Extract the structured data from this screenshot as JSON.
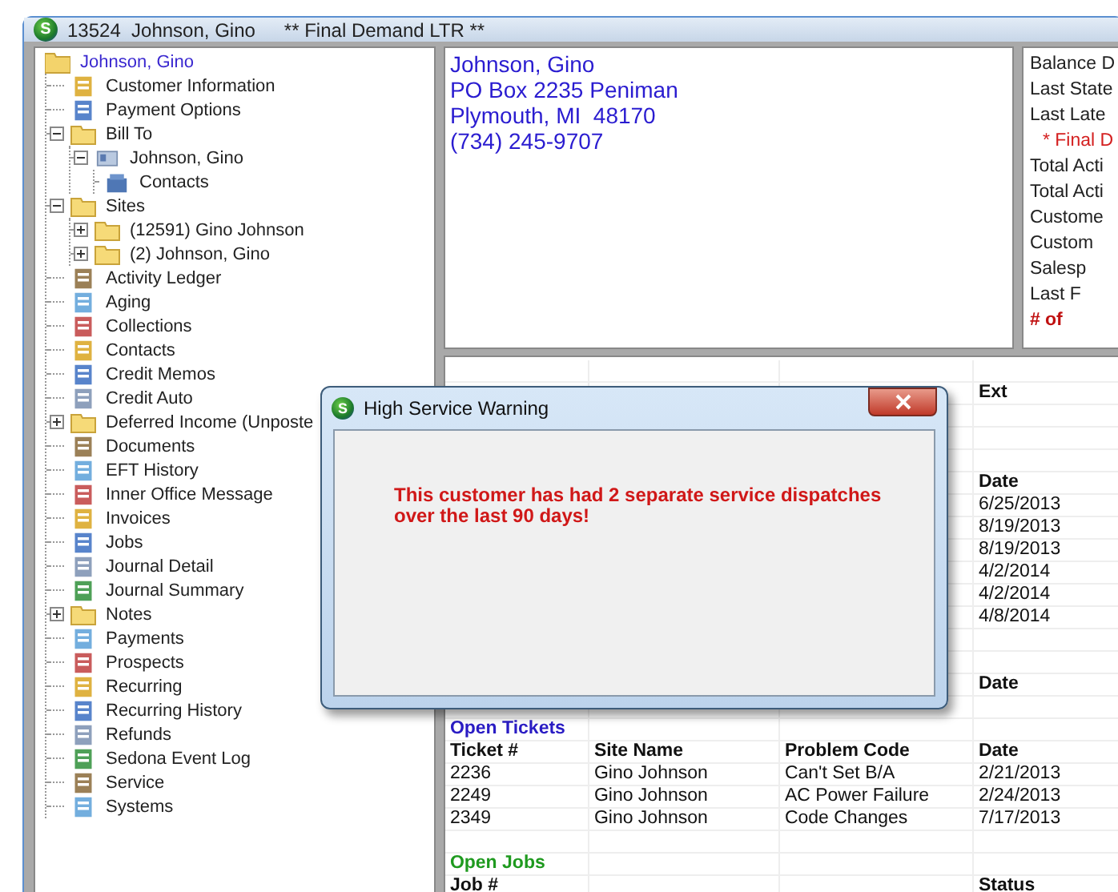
{
  "window": {
    "logo": "S",
    "title": "13524  Johnson, Gino",
    "banner": "** Final Demand LTR **"
  },
  "tree": [
    {
      "label": "Johnson, Gino",
      "kind": "folder",
      "selected": true,
      "children": [
        {
          "label": "Customer Information",
          "kind": "item",
          "selected": false
        },
        {
          "label": "Payment Options",
          "kind": "item",
          "selected": false
        },
        {
          "label": "Bill To",
          "kind": "folder",
          "selected": false,
          "expanded": true,
          "children": [
            {
              "label": "Johnson, Gino",
              "kind": "item",
              "selected": false,
              "expanded": true,
              "children": [
                {
                  "label": "Contacts",
                  "kind": "item",
                  "selected": false
                }
              ]
            }
          ]
        },
        {
          "label": "Sites",
          "kind": "folder",
          "selected": false,
          "expanded": true,
          "children": [
            {
              "label": "(12591) Gino Johnson",
              "kind": "folder",
              "selected": false,
              "expanded": false
            },
            {
              "label": "(2) Johnson, Gino",
              "kind": "folder",
              "selected": false,
              "expanded": false
            }
          ]
        },
        {
          "label": "Activity Ledger",
          "kind": "item",
          "selected": false
        },
        {
          "label": "Aging",
          "kind": "item",
          "selected": false
        },
        {
          "label": "Collections",
          "kind": "item",
          "selected": false
        },
        {
          "label": "Contacts",
          "kind": "item",
          "selected": false
        },
        {
          "label": "Credit Memos",
          "kind": "item",
          "selected": false
        },
        {
          "label": "Credit Auto",
          "kind": "item",
          "selected": false
        },
        {
          "label": "Deferred Income (Unposte",
          "kind": "folder",
          "selected": false,
          "expanded": false
        },
        {
          "label": "Documents",
          "kind": "item",
          "selected": false
        },
        {
          "label": "EFT History",
          "kind": "item",
          "selected": false
        },
        {
          "label": "Inner Office Message",
          "kind": "item",
          "selected": false
        },
        {
          "label": "Invoices",
          "kind": "item",
          "selected": false
        },
        {
          "label": "Jobs",
          "kind": "item",
          "selected": false
        },
        {
          "label": "Journal Detail",
          "kind": "item",
          "selected": false
        },
        {
          "label": "Journal Summary",
          "kind": "item",
          "selected": false
        },
        {
          "label": "Notes",
          "kind": "folder",
          "selected": false,
          "expanded": false
        },
        {
          "label": "Payments",
          "kind": "item",
          "selected": false
        },
        {
          "label": "Prospects",
          "kind": "item",
          "selected": false
        },
        {
          "label": "Recurring",
          "kind": "item",
          "selected": false
        },
        {
          "label": "Recurring History",
          "kind": "item",
          "selected": false
        },
        {
          "label": "Refunds",
          "kind": "item",
          "selected": false
        },
        {
          "label": "Sedona Event Log",
          "kind": "item",
          "selected": false
        },
        {
          "label": "Service",
          "kind": "item",
          "selected": false
        },
        {
          "label": "Systems",
          "kind": "item",
          "selected": false
        }
      ]
    }
  ],
  "address": [
    "Johnson, Gino",
    "PO Box 2235 Peniman",
    "Plymouth, MI  48170",
    "(734) 245-9707"
  ],
  "summary": [
    {
      "text": "Balance D",
      "kind": "normal"
    },
    {
      "text": "Last State",
      "kind": "normal"
    },
    {
      "text": "Last Late",
      "kind": "normal"
    },
    {
      "text": "* Final D",
      "kind": "alert"
    },
    {
      "text": "Total Acti",
      "kind": "normal"
    },
    {
      "text": "Total Acti",
      "kind": "normal"
    },
    {
      "text": "Custome",
      "kind": "normal"
    },
    {
      "text": "Custom",
      "kind": "normal"
    },
    {
      "text": "Salesp",
      "kind": "normal"
    },
    {
      "text": "Last F",
      "kind": "normal"
    },
    {
      "text": "# of",
      "kind": "warning"
    }
  ],
  "grid": [
    {
      "kind": "blank"
    },
    {
      "kind": "header",
      "column_4": "Ext"
    },
    {
      "kind": "blank"
    },
    {
      "kind": "blank"
    },
    {
      "kind": "blank"
    },
    {
      "kind": "header",
      "column_4": "Date"
    },
    {
      "kind": "row",
      "column_4": "6/25/2013"
    },
    {
      "kind": "row",
      "column_4": "8/19/2013"
    },
    {
      "kind": "row",
      "column_4": "8/19/2013"
    },
    {
      "kind": "row",
      "column_4": "4/2/2014"
    },
    {
      "kind": "row",
      "column_4": "4/2/2014"
    },
    {
      "kind": "row",
      "column_4": "4/8/2014"
    },
    {
      "kind": "blank"
    },
    {
      "kind": "blank"
    },
    {
      "kind": "header",
      "column_4": "Date"
    },
    {
      "kind": "blank"
    },
    {
      "kind": "section",
      "column_1": "Open Tickets",
      "color": "#2a1cc4"
    },
    {
      "kind": "header",
      "column_1": "Ticket #",
      "column_2": "Site Name",
      "column_3": "Problem Code",
      "column_4": "Date"
    },
    {
      "kind": "row",
      "column_1": "2236",
      "column_2": "Gino Johnson",
      "column_3": "Can't Set B/A",
      "column_4": "2/21/2013"
    },
    {
      "kind": "row",
      "column_1": "2249",
      "column_2": "Gino Johnson",
      "column_3": "AC Power Failure",
      "column_4": "2/24/2013"
    },
    {
      "kind": "row",
      "column_1": "2349",
      "column_2": "Gino Johnson",
      "column_3": "Code Changes",
      "column_4": "7/17/2013"
    },
    {
      "kind": "blank"
    },
    {
      "kind": "section",
      "column_1": "Open Jobs",
      "color": "#1f9a1f"
    },
    {
      "kind": "header",
      "column_1": "Job #",
      "column_4": "Status"
    }
  ],
  "dialog": {
    "logo": "S",
    "title": "High Service Warning",
    "message": [
      "This customer has had 2 separate service dispatches",
      "over the last 90 days!"
    ]
  }
}
